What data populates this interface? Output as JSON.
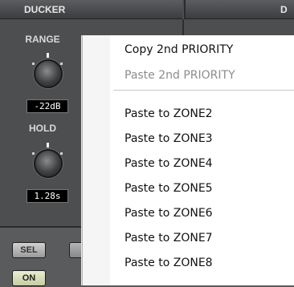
{
  "panel": {
    "header_left": "DUCKER",
    "header_right": "D",
    "range": {
      "label": "RANGE",
      "value": "-22dB"
    },
    "hold": {
      "label": "HOLD",
      "value": "1.28s"
    },
    "buttons": {
      "sel": "SEL",
      "on": "ON"
    }
  },
  "menu": {
    "items": [
      {
        "label": "Copy 2nd PRIORITY",
        "enabled": true
      },
      {
        "label": "Paste 2nd PRIORITY",
        "enabled": false
      },
      {
        "label": "Paste to ZONE2",
        "enabled": true
      },
      {
        "label": "Paste to ZONE3",
        "enabled": true
      },
      {
        "label": "Paste to ZONE4",
        "enabled": true
      },
      {
        "label": "Paste to ZONE5",
        "enabled": true
      },
      {
        "label": "Paste to ZONE6",
        "enabled": true
      },
      {
        "label": "Paste to ZONE7",
        "enabled": true
      },
      {
        "label": "Paste to ZONE8",
        "enabled": true
      }
    ]
  },
  "colors": {
    "panel_bg": "#4d4e50",
    "menu_bg": "#ffffff",
    "disabled_text": "#8c8c8c",
    "on_button": "#dfe5c0"
  }
}
